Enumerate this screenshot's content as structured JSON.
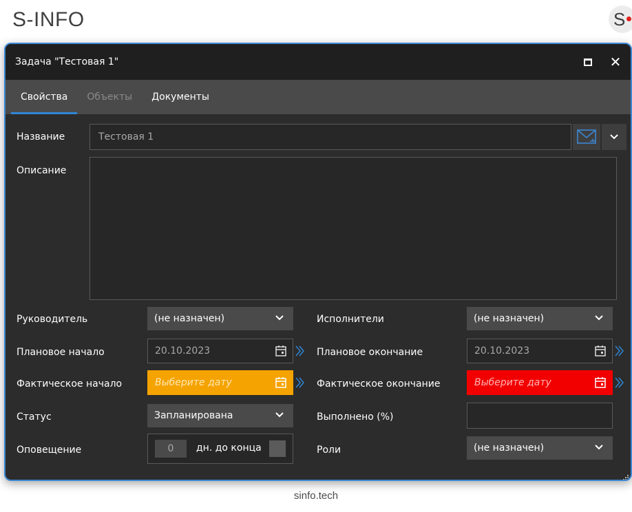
{
  "app": {
    "brand": "S-INFO",
    "logo_letter": "S",
    "footer": "sinfo.tech"
  },
  "window": {
    "title": "Задача \"Тестовая 1\""
  },
  "tabs": [
    {
      "label": "Свойства",
      "active": true
    },
    {
      "label": "Объекты",
      "disabled": true
    },
    {
      "label": "Документы"
    }
  ],
  "form": {
    "name_label": "Название",
    "name_value": "Тестовая 1",
    "description_label": "Описание",
    "description_value": "",
    "manager_label": "Руководитель",
    "manager_value": "(не назначен)",
    "executors_label": "Исполнители",
    "executors_value": "(не назначен)",
    "plan_start_label": "Плановое начало",
    "plan_start_value": "20.10.2023",
    "plan_end_label": "Плановое окончание",
    "plan_end_value": "20.10.2023",
    "actual_start_label": "Фактическое начало",
    "actual_start_placeholder": "Выберите дату",
    "actual_end_label": "Фактическое окончание",
    "actual_end_placeholder": "Выберите дату",
    "status_label": "Статус",
    "status_value": "Запланирована",
    "done_label": "Выполнено (%)",
    "done_value": "",
    "notify_label": "Оповещение",
    "notify_days": "0",
    "notify_suffix": "дн. до конца",
    "roles_label": "Роли",
    "roles_value": "(не назначен)"
  },
  "colors": {
    "accent": "#3d88d4",
    "warning": "#f5a300",
    "error": "#f20000"
  }
}
